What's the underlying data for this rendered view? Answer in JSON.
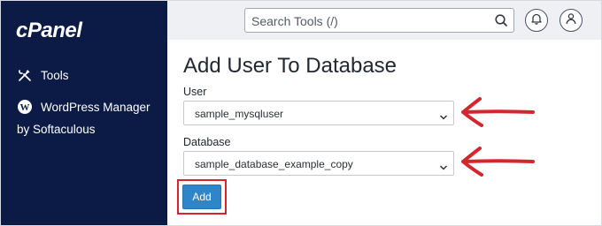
{
  "sidebar": {
    "logo": "cPanel",
    "items": [
      {
        "label": "Tools",
        "icon": "tools-icon"
      },
      {
        "label": "WordPress Manager",
        "label2": "by Softaculous",
        "icon": "wordpress-icon"
      }
    ]
  },
  "header": {
    "search_placeholder": "Search Tools (/)",
    "search_icon": "search-icon",
    "notifications_icon": "bell-icon",
    "user_icon": "user-icon"
  },
  "main": {
    "title": "Add User To Database",
    "user_label": "User",
    "user_value": "sample_mysqluser",
    "database_label": "Database",
    "database_value": "sample_database_example_copy",
    "add_label": "Add"
  },
  "colors": {
    "sidebar_bg": "#0b1b45",
    "button_blue": "#2e86c9",
    "annotation_red": "#d6262d"
  }
}
